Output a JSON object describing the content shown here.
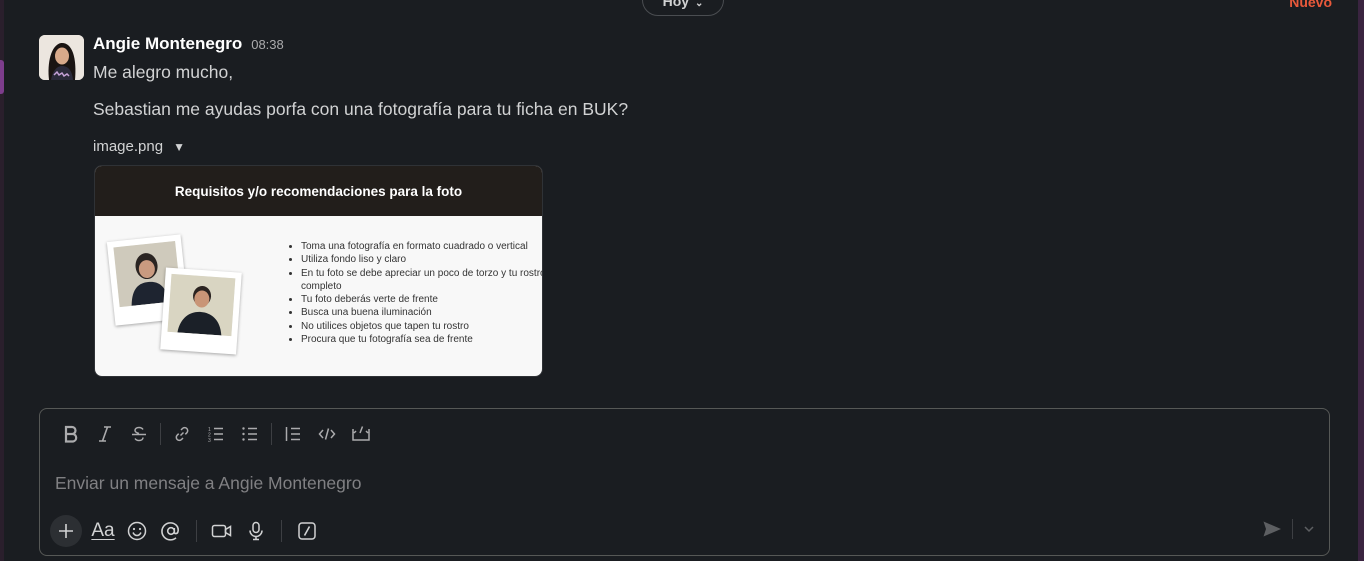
{
  "divider": {
    "date_label": "Hoy",
    "new_label": "Nuevo"
  },
  "message": {
    "author": "Angie Montenegro",
    "time": "08:38",
    "line1": "Me alegro mucho,",
    "line2": "Sebastian me ayudas porfa con una fotografía para tu ficha en BUK?",
    "file_name": "image.png"
  },
  "attachment": {
    "title": "Requisitos y/o recomendaciones para la foto",
    "items": [
      "Toma una fotografía en formato cuadrado o vertical",
      "Utiliza fondo liso y claro",
      "En tu foto se debe apreciar un poco de torzo y tu rostro completo",
      "Tu foto deberás verte de frente",
      "Busca una buena iluminación",
      "No utilices objetos que tapen tu rostro",
      "Procura que tu fotografía sea de frente"
    ]
  },
  "composer": {
    "placeholder": "Enviar un mensaje a Angie Montenegro",
    "format_label": "Aa"
  },
  "colors": {
    "background": "#1a1d21",
    "accent_new": "#e8593b",
    "text": "#d1d2d3"
  }
}
